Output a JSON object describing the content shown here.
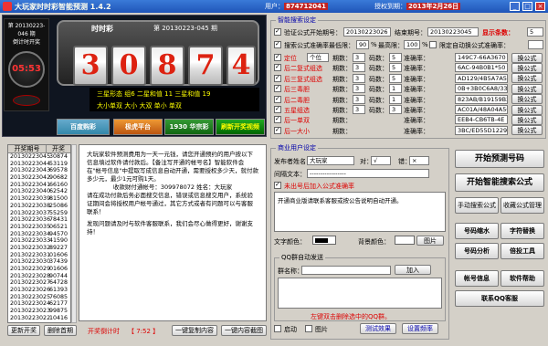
{
  "title": {
    "app": "大玩家时时彩智能预测 1.4.2",
    "user_label": "用户：",
    "user_value": "874712041",
    "auth_label": "授权到期：",
    "auth_value": "2013年2月26日"
  },
  "left_top": {
    "period_line1": "第 20130223-046 期",
    "period_line2": "倒计时开奖",
    "clock_time": "05:53",
    "lottery_name": "时时彩",
    "period": "第 20130223-045 期",
    "digits": [
      "3",
      "0",
      "8",
      "7",
      "4"
    ],
    "stats": {
      "line1": "三星形态  组6  二星和值 11  三星和值 19",
      "line2": "大小单双  大小 大双  单小 单双"
    },
    "buttons": {
      "bdj": "百度购彩",
      "bd_sub": "BAIDU.COM",
      "yjpt": "极虎平台",
      "hq": "1930 华宗彩",
      "refresh": "刷新开奖视频"
    }
  },
  "smart": {
    "legend": "智能搜索设定",
    "verify_label": "验证公式开始期号：",
    "start_period": "20130223026",
    "end_label": "结束期号：",
    "end_period": "20130223045",
    "show_label": "显示条数：",
    "show_count": "5",
    "acc_label": "搜索公式准确率最低限：",
    "acc_value": "90",
    "pct": "%",
    "max_label": "最高限：",
    "max_value": "100",
    "limit_label": "限定自动换公式准确率：",
    "rows": [
      {
        "label": "定位",
        "pos": "个位",
        "a": "期数：",
        "b": "3",
        "c": "码数：",
        "d": "5",
        "e": "准确率：",
        "formula": "149C7-66A3670",
        "btn": "换公式"
      },
      {
        "label": "后二复式组选",
        "pos": "",
        "a": "期数：",
        "b": "3",
        "c": "码数：",
        "d": "5",
        "e": "准确率：",
        "formula": "6AC-94B0B1*50",
        "btn": "换公式"
      },
      {
        "label": "后三复式组选",
        "pos": "",
        "a": "期数：",
        "b": "3",
        "c": "码数：",
        "d": "5",
        "e": "准确率：",
        "formula": "AD129/4B5A7A5",
        "btn": "换公式"
      },
      {
        "label": "后三毒胆",
        "pos": "",
        "a": "期数：",
        "b": "3",
        "c": "码数：",
        "d": "1",
        "e": "准确率：",
        "formula": "0B+3B0C6A8/333",
        "btn": "换公式"
      },
      {
        "label": "后二毒胆",
        "pos": "",
        "a": "期数：",
        "b": "3",
        "c": "码数：",
        "d": "1",
        "e": "准确率：",
        "formula": "823AB/B19159B2",
        "btn": "换公式"
      },
      {
        "label": "五星组选",
        "pos": "",
        "a": "期数：",
        "b": "3",
        "c": "码数：",
        "d": "3",
        "e": "准确率：",
        "formula": "AC01A/48A04A5C",
        "btn": "换公式"
      },
      {
        "label": "后一单双",
        "pos": "",
        "a": "期数：",
        "b": "",
        "c": "",
        "d": "",
        "e": "准确率：",
        "formula": "EEB4-CB6TB-4E",
        "btn": "换公式"
      },
      {
        "label": "后一大小",
        "pos": "",
        "a": "期数：",
        "b": "",
        "c": "",
        "d": "",
        "e": "准确率：",
        "formula": "3BC/ED55D12299",
        "btn": "换公式"
      }
    ]
  },
  "history": {
    "col1": "开奖期号",
    "col2": "开奖",
    "rows": [
      [
        "20130223045",
        "30874"
      ],
      [
        "20130223044",
        "53119"
      ],
      [
        "20130223043",
        "69578"
      ],
      [
        "20130223042",
        "90682"
      ],
      [
        "20130223041",
        "66160"
      ],
      [
        "20130223040",
        "62542"
      ],
      [
        "20130223039",
        "81500"
      ],
      [
        "20130223038",
        "25086"
      ],
      [
        "20130223037",
        "55259"
      ],
      [
        "20130223036",
        "78431"
      ],
      [
        "20130223035",
        "06521"
      ],
      [
        "20130223034",
        "94570"
      ],
      [
        "20130223033",
        "41590"
      ],
      [
        "20130223032",
        "89227"
      ],
      [
        "20130223031",
        "01606"
      ],
      [
        "20130223030",
        "37439"
      ],
      [
        "20130223029",
        "01606"
      ],
      [
        "20130223028",
        "90744"
      ],
      [
        "20130223027",
        "64728"
      ],
      [
        "20130223026",
        "61393"
      ],
      [
        "20130223025",
        "76085"
      ],
      [
        "20130223024",
        "62177"
      ],
      [
        "20130223023",
        "99875"
      ],
      [
        "20130223022",
        "10416"
      ]
    ],
    "refresh_btn": "更新开奖",
    "delete_btn": "删除首期"
  },
  "notice": {
    "p1": "大玩家软件预测费用为一天一元钱，请您开通预约的用户按以下信息填过软件请付款后。【备注写开通的帐号名】智能软件会在\"帐号信息\"中提取写成信息自动开通，需要授权多少天，就付款多少元，最少1元可购1天。",
    "p2": "收款财付通帐号：309978072  姓名：大玩家",
    "p3": "请在成功付款后务必面搜交信息，错误或信息搜交用户，系统验证期间会将授权用户帐号通过，其它方式或者有问题可以与客服联系！",
    "p4": "发现问题请及时与软件客服联系，我们会尽心做得更好，谢谢支持！"
  },
  "bottom": {
    "countdown_label": "开奖倒计时",
    "countdown_value": "【 7:52 】",
    "copy_btn": "一键复制内容",
    "cut_btn": "一键内容截图"
  },
  "merchant": {
    "legend": "商业用户设定",
    "publisher_label": "发布者姓名：",
    "publisher_value": "大玩家",
    "right_label": "对：",
    "right_value": "√",
    "wrong_label": "错：",
    "wrong_value": "×",
    "sep_label": "间隔文本：",
    "sep_value": "-----------------",
    "chk_label": "未出号后加入公式准确率",
    "content": "开通商业版请联系客服或按公告说明自动开通。",
    "text_color_label": "文字颜色：",
    "bg_color_label": "背景颜色：",
    "bg_btn": "图片",
    "qq_legend": "QQ群自动发送",
    "group_label": "群名称：",
    "add_btn": "加入",
    "hint": "左键双击删除选中的QQ群。",
    "start_label": "启动",
    "pic_label": "图片",
    "test_btn": "测试效果",
    "freq_btn": "设置频率"
  },
  "right": {
    "start_predict": "开始预测号码",
    "start_search": "开始智能搜索公式",
    "manual": "手动搜索公式",
    "collect": "收藏公式管理",
    "num_shrink": "号码缩水",
    "char_replace": "字符替换",
    "num_analyze": "号码分析",
    "odds_tool": "倍投工具",
    "account": "帐号信息",
    "help": "软件帮助",
    "contact": "联系QQ客服"
  },
  "colors": {
    "red": "#d00000",
    "blue": "#1f55b8",
    "panel": "#d4d0c8"
  }
}
